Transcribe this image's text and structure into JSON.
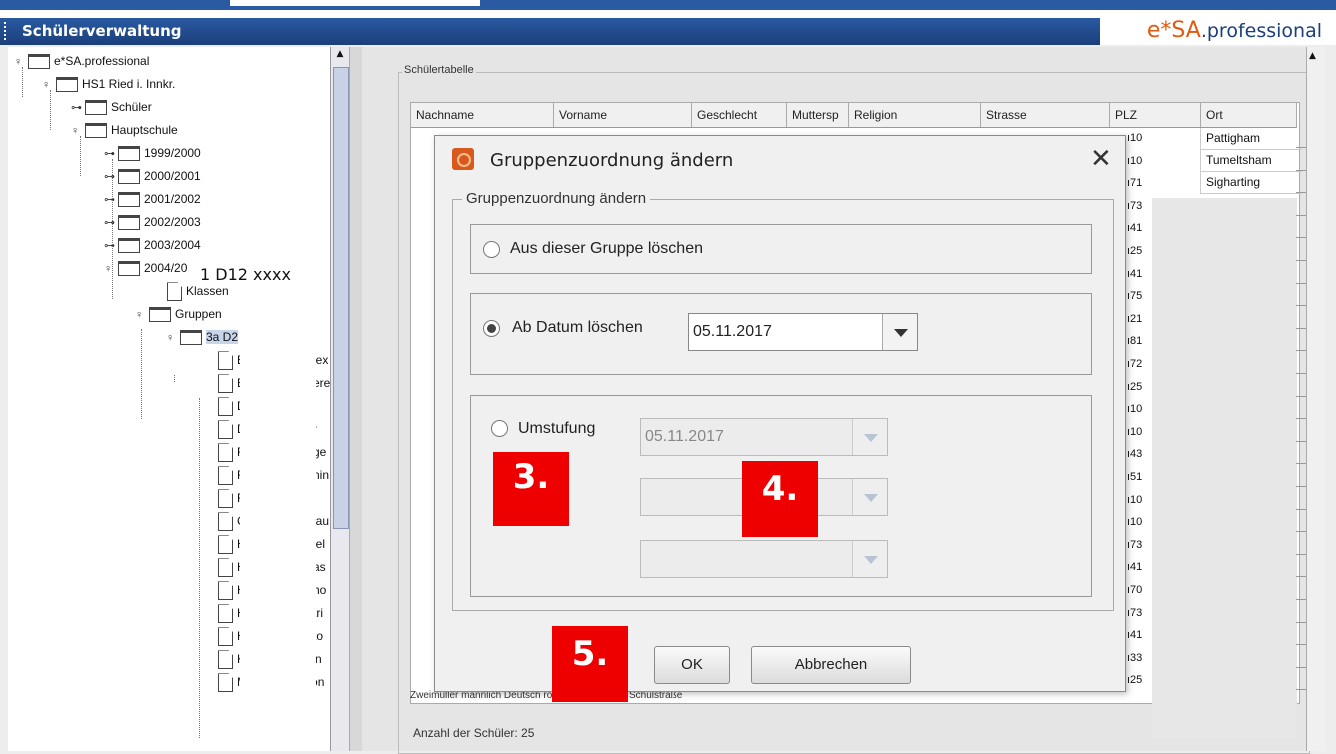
{
  "window": {
    "title": "Schülerverwaltung",
    "logo_a": "e*SA",
    "logo_b": ".professional"
  },
  "tree": {
    "items": [
      {
        "label": "e*SA.professional",
        "type": "folder",
        "expand": "⊸"
      },
      {
        "label": "HS1 Ried i. Innkr.",
        "type": "folder",
        "expand": "⊸"
      },
      {
        "label": "Schüler",
        "type": "folder",
        "expand": "⊶"
      },
      {
        "label": "Hauptschule",
        "type": "folder",
        "expand": "⊸"
      },
      {
        "label": "1999/2000",
        "type": "folder",
        "expand": "⊶"
      },
      {
        "label": "2000/2001",
        "type": "folder",
        "expand": "⊶"
      },
      {
        "label": "2001/2002",
        "type": "folder",
        "expand": "⊶"
      },
      {
        "label": "2002/2003",
        "type": "folder",
        "expand": "⊶"
      },
      {
        "label": "2003/2004",
        "type": "folder",
        "expand": "⊶"
      },
      {
        "label": "2004/20",
        "type": "folder",
        "expand": "⊸"
      },
      {
        "label": "Klassen",
        "type": "doc",
        "expand": ""
      },
      {
        "label": "Gruppen",
        "type": "folder",
        "expand": "⊸"
      },
      {
        "label": "3a D2",
        "type": "folder",
        "expand": "⊸"
      },
      {
        "label": "B",
        "type": "doc",
        "expand": "",
        "suffix": "lex"
      },
      {
        "label": "B",
        "type": "doc",
        "expand": "",
        "suffix": "ere"
      },
      {
        "label": "D",
        "type": "doc",
        "expand": "",
        "suffix": "l"
      },
      {
        "label": "D",
        "type": "doc",
        "expand": "",
        "suffix": "r"
      },
      {
        "label": "F",
        "type": "doc",
        "expand": "",
        "suffix": "ge"
      },
      {
        "label": "F",
        "type": "doc",
        "expand": "",
        "suffix": "nin"
      },
      {
        "label": "F",
        "type": "doc",
        "expand": "",
        "suffix": ""
      },
      {
        "label": "G",
        "type": "doc",
        "expand": "",
        "suffix": "lau"
      },
      {
        "label": "H",
        "type": "doc",
        "expand": "",
        "suffix": "iel"
      },
      {
        "label": "H",
        "type": "doc",
        "expand": "",
        "suffix": "as"
      },
      {
        "label": "H",
        "type": "doc",
        "expand": "",
        "suffix": "ho"
      },
      {
        "label": "H",
        "type": "doc",
        "expand": "",
        "suffix": "tri"
      },
      {
        "label": "H",
        "type": "doc",
        "expand": "",
        "suffix": "to"
      },
      {
        "label": "Kastraoti Adrian",
        "type": "doc",
        "expand": ""
      },
      {
        "label": "Meiringer Simon",
        "type": "doc",
        "expand": ""
      }
    ],
    "tooltip": "1 D12 xxxx"
  },
  "table": {
    "legend": "Schülertabelle",
    "columns": [
      "Nachname",
      "Vorname",
      "Geschlecht",
      "Muttersp",
      "Religion",
      "Strasse",
      "PLZ",
      "Ort"
    ],
    "plz": [
      "10",
      "10",
      "71",
      "73",
      "41",
      "25",
      "41",
      "75",
      "21",
      "81",
      "72",
      "25",
      "10",
      "10",
      "43",
      "51",
      "10",
      "10",
      "73",
      "41",
      "70",
      "73",
      "41",
      "33",
      "25"
    ],
    "orte": [
      "Pattigham",
      "Tumeltsham",
      "Sigharting"
    ],
    "bottom_row": "Zweimüller    männlich    Deutsch    römisch-katholisch    Schulstraße",
    "count": "Anzahl der Schüler: 25"
  },
  "dialog": {
    "title": "Gruppenzuordnung ändern",
    "group_legend": "Gruppenzuordnung ändern",
    "option1": "Aus dieser Gruppe löschen",
    "option2": "Ab Datum löschen",
    "option2_date": "05.11.2017",
    "option3": "Umstufung",
    "option3_date": "05.11.2017",
    "ok": "OK",
    "cancel": "Abbrechen"
  },
  "markers": {
    "m3": "3.",
    "m4": "4.",
    "m5": "5."
  },
  "colors": {
    "titlebar": "#1b3f7a",
    "marker": "#ee0000",
    "logo_accent": "#e05a10"
  }
}
